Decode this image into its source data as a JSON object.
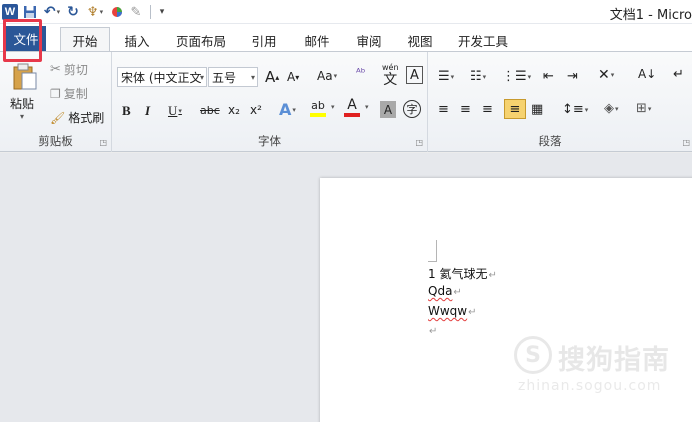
{
  "titlebar": {
    "app_icon": "W",
    "title": "文档1 - Micro",
    "qat_icons": [
      "save-icon",
      "undo-icon",
      "redo-icon",
      "format-painter-icon",
      "color-icon",
      "pen-icon",
      "customize-icon"
    ]
  },
  "tabs": [
    {
      "label": "文件"
    },
    {
      "label": "开始"
    },
    {
      "label": "插入"
    },
    {
      "label": "页面布局"
    },
    {
      "label": "引用"
    },
    {
      "label": "邮件"
    },
    {
      "label": "审阅"
    },
    {
      "label": "视图"
    },
    {
      "label": "开发工具"
    }
  ],
  "ribbon": {
    "clipboard": {
      "label": "剪贴板",
      "paste": "粘贴",
      "cut": "剪切",
      "copy": "复制",
      "format_painter": "格式刷"
    },
    "font": {
      "label": "字体",
      "font_name": "宋体 (中文正文",
      "font_size": "五号",
      "grow": "A",
      "shrink": "A",
      "case": "Aa",
      "clear": "ᴬᵇ",
      "phonetic": "wén",
      "phonetic_char": "文",
      "border_char": "A",
      "bold": "B",
      "italic": "I",
      "underline": "U",
      "strike": "abc",
      "subscript": "x₂",
      "superscript": "x²",
      "effects": "A",
      "highlight": "ab",
      "font_color": "A",
      "shading_char": "A",
      "enclose_char": "字"
    },
    "paragraph": {
      "label": "段落"
    }
  },
  "colors": {
    "file_tab": "#2b5797",
    "highlight_box": "#e7384a",
    "highlight_yellow": "#ffff00",
    "font_red": "#e02020"
  },
  "document": {
    "lines": [
      "1 氦气球无",
      "Qda",
      "Wwqw"
    ]
  },
  "watermark": {
    "logo_letter": "S",
    "text": "搜狗指南",
    "url": "zhinan.sogou.com"
  }
}
